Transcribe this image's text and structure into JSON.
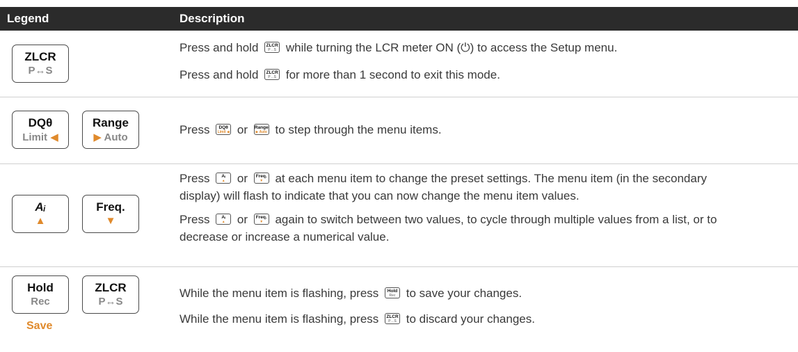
{
  "header": {
    "legend": "Legend",
    "description": "Description"
  },
  "keys": {
    "zlcr": {
      "top": "ZLCR",
      "bottom": "P↔S"
    },
    "dq": {
      "top": "DQθ",
      "bottom": "Limit ◂"
    },
    "range": {
      "top": "Range",
      "bottom": "▸ Auto"
    },
    "ai": {
      "top": "Aᵢ",
      "bottom": "▲"
    },
    "freq": {
      "top": "Freq.",
      "bottom": "▼"
    },
    "hold": {
      "top": "Hold",
      "bottom": "Rec"
    },
    "save": "Save"
  },
  "rows": [
    {
      "lines": [
        {
          "pre": "Press and hold",
          "post": "while turning the LCR meter ON (⏻) to access the Setup menu."
        },
        {
          "pre": "Press and hold",
          "post": "for more than 1 second to exit this mode."
        }
      ]
    },
    {
      "pre": "Press",
      "mid": "or",
      "post": "to step through the menu items."
    },
    {
      "p1_pre": "Press",
      "p1_mid": "or",
      "p1_post": "at each menu item to change the preset settings. The menu item (in the secondary",
      "p1_line2": "display) will flash to indicate that you can now change the menu item values.",
      "p2_pre": "Press",
      "p2_mid": "or",
      "p2_post": "again to switch between two values, to cycle through multiple values from a list, or to",
      "p2_line2": "decrease or increase a numerical value."
    },
    {
      "l1_pre": "While the menu item is flashing, press",
      "l1_post": "to save your changes.",
      "l2_pre": "While the menu item is flashing, press",
      "l2_post": "to discard your changes."
    }
  ],
  "colors": {
    "header_bg": "#2b2b2b",
    "accent": "#e08a2c"
  }
}
